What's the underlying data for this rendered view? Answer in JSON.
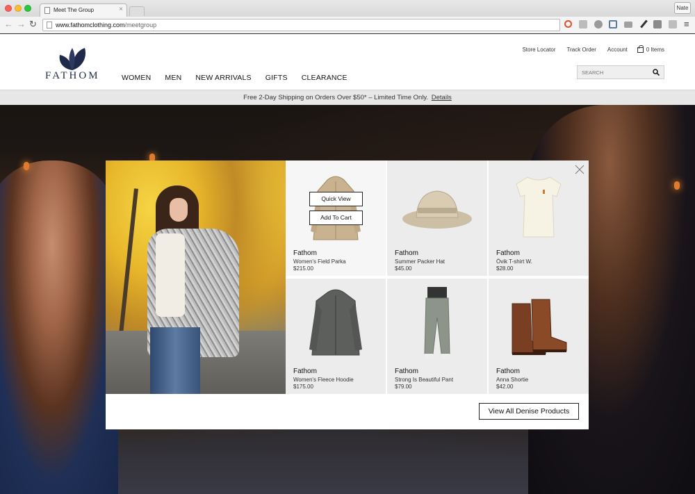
{
  "browser": {
    "tab_title": "Meet The Group",
    "url_host": "www.fathomclothing.com",
    "url_path": "/meetgroup",
    "user": "Nate"
  },
  "header": {
    "logo_text": "FATHOM",
    "nav": [
      "WOMEN",
      "MEN",
      "NEW ARRIVALS",
      "GIFTS",
      "CLEARANCE"
    ],
    "util": {
      "store_locator": "Store Locator",
      "track_order": "Track Order",
      "account": "Account",
      "cart": "0 Items"
    },
    "search_placeholder": "SEARCH"
  },
  "promo": {
    "text": "Free 2-Day Shipping on Orders Over $50* – Limited Time Only.",
    "link": "Details"
  },
  "modal": {
    "quick_view": "Quick View",
    "add_to_cart": "Add To Cart",
    "view_all": "View All Denise Products",
    "products": [
      {
        "brand": "Fathom",
        "name": "Women's Field Parka",
        "price": "$215.00",
        "icon": "parka"
      },
      {
        "brand": "Fathom",
        "name": "Summer Packer Hat",
        "price": "$45.00",
        "icon": "hat"
      },
      {
        "brand": "Fathom",
        "name": "Övik T-shirt W.",
        "price": "$28.00",
        "icon": "tshirt"
      },
      {
        "brand": "Fathom",
        "name": "Women's Fleece Hoodie",
        "price": "$175.00",
        "icon": "hoodie"
      },
      {
        "brand": "Fathom",
        "name": "Strong Is Beautiful Pant",
        "price": "$79.00",
        "icon": "pant"
      },
      {
        "brand": "Fathom",
        "name": "Anna Shortie",
        "price": "$42.00",
        "icon": "boots"
      }
    ]
  },
  "colors": {
    "brand_navy": "#1f2a4a",
    "promo_bg": "#e7e7e7"
  }
}
